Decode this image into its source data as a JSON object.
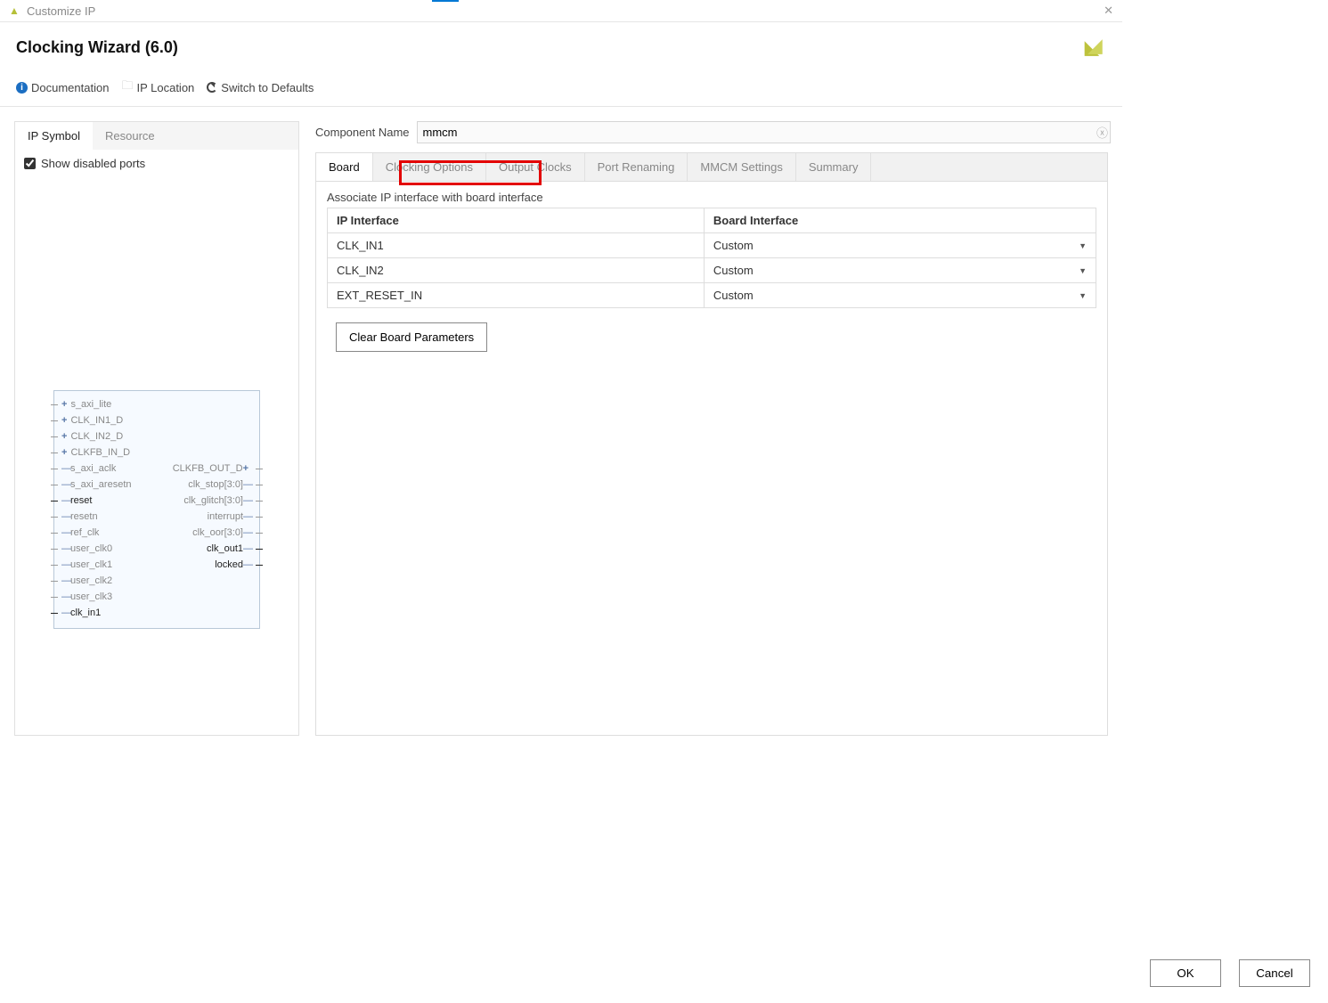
{
  "window": {
    "title": "Customize IP"
  },
  "wizard": {
    "title": "Clocking Wizard (6.0)"
  },
  "toolbar": {
    "documentation": "Documentation",
    "ip_location": "IP Location",
    "switch_defaults": "Switch to Defaults"
  },
  "left": {
    "tabs": {
      "symbol": "IP Symbol",
      "resource": "Resource"
    },
    "show_disabled_label": "Show disabled ports",
    "show_disabled_checked": true,
    "ports_left": [
      {
        "label": "s_axi_lite",
        "plus": true,
        "active": false
      },
      {
        "label": "CLK_IN1_D",
        "plus": true,
        "active": false
      },
      {
        "label": "CLK_IN2_D",
        "plus": true,
        "active": false
      },
      {
        "label": "CLKFB_IN_D",
        "plus": true,
        "active": false
      },
      {
        "label": "s_axi_aclk",
        "plus": false,
        "active": false
      },
      {
        "label": "s_axi_aresetn",
        "plus": false,
        "active": false
      },
      {
        "label": "reset",
        "plus": false,
        "active": true
      },
      {
        "label": "resetn",
        "plus": false,
        "active": false
      },
      {
        "label": "ref_clk",
        "plus": false,
        "active": false
      },
      {
        "label": "user_clk0",
        "plus": false,
        "active": false
      },
      {
        "label": "user_clk1",
        "plus": false,
        "active": false
      },
      {
        "label": "user_clk2",
        "plus": false,
        "active": false
      },
      {
        "label": "user_clk3",
        "plus": false,
        "active": false
      },
      {
        "label": "clk_in1",
        "plus": false,
        "active": true
      }
    ],
    "ports_right": [
      {
        "label": "CLKFB_OUT_D",
        "plus": true,
        "active": false
      },
      {
        "label": "clk_stop[3:0]",
        "plus": false,
        "active": false
      },
      {
        "label": "clk_glitch[3:0]",
        "plus": false,
        "active": false
      },
      {
        "label": "interrupt",
        "plus": false,
        "active": false
      },
      {
        "label": "clk_oor[3:0]",
        "plus": false,
        "active": false
      },
      {
        "label": "clk_out1",
        "plus": false,
        "active": true
      },
      {
        "label": "locked",
        "plus": false,
        "active": true
      }
    ]
  },
  "component_name": {
    "label": "Component Name",
    "value": "mmcm"
  },
  "config_tabs": [
    "Board",
    "Clocking Options",
    "Output Clocks",
    "Port Renaming",
    "MMCM Settings",
    "Summary"
  ],
  "board": {
    "assoc_text": "Associate IP interface with board interface",
    "headers": {
      "ip": "IP Interface",
      "board": "Board Interface"
    },
    "rows": [
      {
        "ip": "CLK_IN1",
        "board": "Custom"
      },
      {
        "ip": "CLK_IN2",
        "board": "Custom"
      },
      {
        "ip": "EXT_RESET_IN",
        "board": "Custom"
      }
    ],
    "clear_btn": "Clear Board Parameters"
  },
  "footer": {
    "ok": "OK",
    "cancel": "Cancel"
  }
}
